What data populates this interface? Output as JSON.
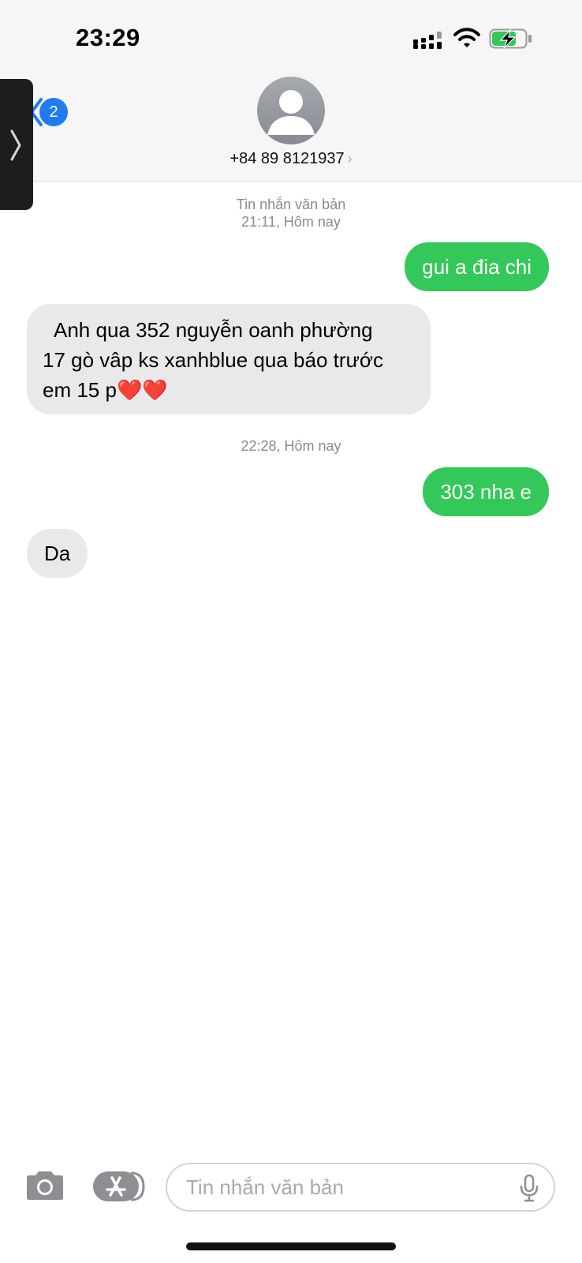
{
  "status_bar": {
    "time": "23:29"
  },
  "header": {
    "unread_badge": "2",
    "contact_number": "+84 89 8121937",
    "contact_chevron": "›"
  },
  "thread": {
    "meta1_line1": "Tin nhắn văn bản",
    "meta1_line2": "21:11, Hôm nay",
    "msg1": "gui a đia chi",
    "msg2_line1": "Anh qua 352 nguyễn oanh phường",
    "msg2_line2": "17 gò vâp ks xanhblue qua báo trước",
    "msg2_line3": "em 15 p❤️❤️",
    "meta2": "22:28, Hôm nay",
    "msg3": "303 nha e",
    "msg4": "Da"
  },
  "composer": {
    "placeholder": "Tin nhắn văn bản"
  },
  "colors": {
    "outgoing": "#34c85a",
    "incoming": "#e9e9eb",
    "accent": "#1f7cf0"
  },
  "icons": [
    "signal-icon",
    "wifi-icon",
    "battery-charging-icon",
    "back-chevron-icon",
    "avatar-person-icon",
    "camera-icon",
    "app-store-icon",
    "microphone-icon"
  ]
}
